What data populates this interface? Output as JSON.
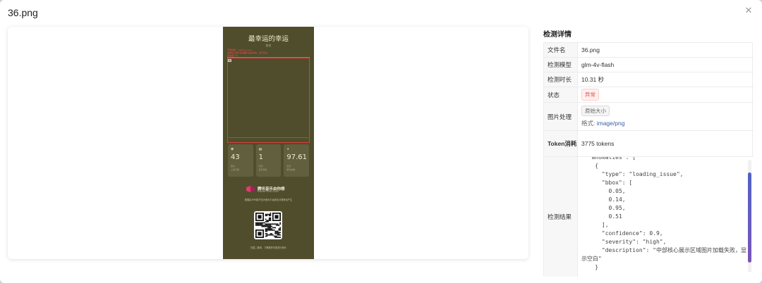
{
  "modal": {
    "title": "36.png",
    "close_glyph": "✕"
  },
  "poster": {
    "title": "最幸运的幸运",
    "subtitle": "排名",
    "anomaly_tag_line1": "严重问题：loading_issue",
    "anomaly_tag_line2": "中部核心展示区域图片加载失败，显示空白",
    "anomaly_tag_line3": "置信度 0.9",
    "stats": [
      {
        "icon": "☻",
        "value": "43",
        "line1": "首次",
        "line2": "上榜日期"
      },
      {
        "icon": "▮▮",
        "value": "1",
        "line1": "历史",
        "line2": "最高排名"
      },
      {
        "icon": "♦",
        "value": "97.61",
        "line1": "最高",
        "line2": "飙升指数"
      }
    ],
    "logo_text": "腾讯音乐由你榜",
    "logo_sub": "TENCENT MUSIC CHART",
    "caption": "数据由TME旗下四大音乐平台综合计算得出产生",
    "qr_caption": "扫描二维码，了解更多华语流行音乐"
  },
  "details": {
    "heading": "检测详情",
    "rows": [
      {
        "label": "文件名",
        "value": "36.png"
      },
      {
        "label": "检测模型",
        "value": "glm-4v-flash"
      },
      {
        "label": "检测时长",
        "value": "10.31 秒"
      },
      {
        "label": "状态",
        "value": "异常"
      },
      {
        "label": "图片处理",
        "size_tag": "原始大小",
        "format_label": "格式: ",
        "format_value": "image/png"
      },
      {
        "label": "Token消耗",
        "value": "3775 tokens"
      },
      {
        "label": "检测结果"
      }
    ],
    "result_json": "  \"anomalies\": [\n    {\n      \"type\": \"loading_issue\",\n      \"bbox\": [\n        0.05,\n        0.14,\n        0.95,\n        0.51\n      ],\n      \"confidence\": 0.9,\n      \"severity\": \"high\",\n      \"description\": \"中部核心展示区域图片加载失败，显\n示空白\"\n    }"
  },
  "colors": {
    "poster_bg": "#4f4d2c",
    "bbox_red": "#e03c3c",
    "status_red": "#e4514b",
    "scroll_thumb": "#5a5fc2"
  }
}
